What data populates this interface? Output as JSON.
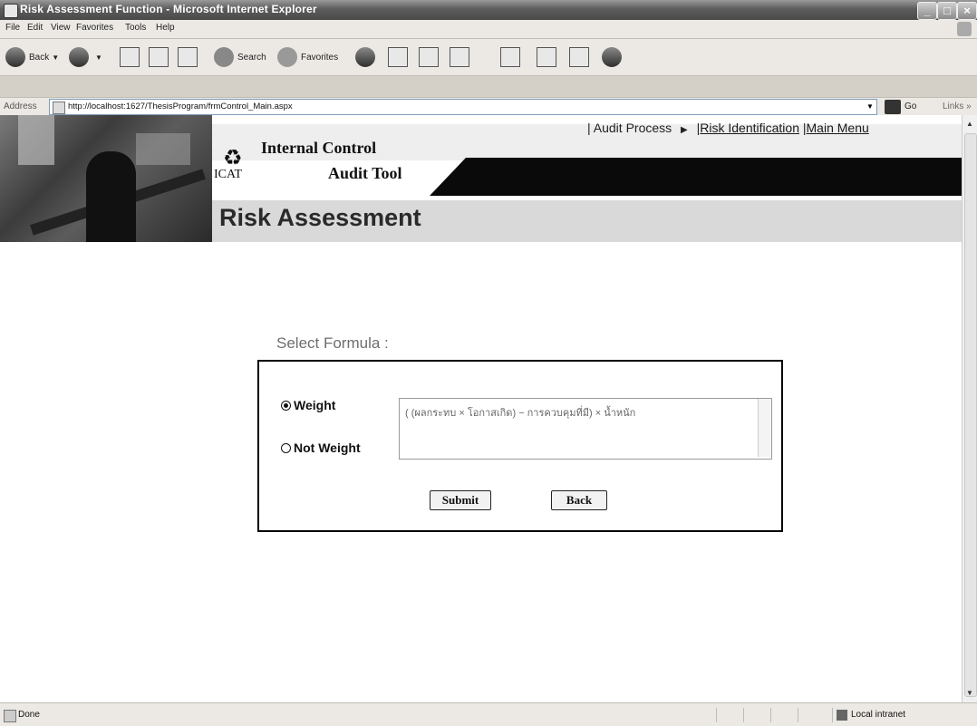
{
  "window": {
    "title": "Risk Assessment Function - Microsoft Internet Explorer"
  },
  "menu": [
    "File",
    "Edit",
    "View",
    "Favorites",
    "Tools",
    "Help"
  ],
  "toolbar": {
    "back": "Back",
    "search": "Search",
    "favorites": "Favorites"
  },
  "address": {
    "label": "Address",
    "url": "http://localhost:1627/ThesisProgram/frmControl_Main.aspx",
    "go": "Go",
    "links": "Links »"
  },
  "header": {
    "line1": "Internal Control",
    "icat": "ICAT",
    "line2": "Audit Tool",
    "banner": "Risk Assessment"
  },
  "nav": {
    "sep1": "|",
    "audit_process": "Audit Process",
    "arrow": "▶",
    "risk_identification": "Risk Identification",
    "sep2": "|",
    "main_menu": "Main Menu"
  },
  "form": {
    "title": "Select Formula :",
    "options": [
      {
        "label": "Weight",
        "selected": true
      },
      {
        "label": "Not Weight",
        "selected": false
      }
    ],
    "formula_text": "( (ผลกระทบ × โอกาสเกิด) − การควบคุมที่มี) × น้ำหนัก",
    "submit_label": "Submit",
    "back_label": "Back"
  },
  "status": {
    "left": "Done",
    "zone": "Local intranet"
  }
}
